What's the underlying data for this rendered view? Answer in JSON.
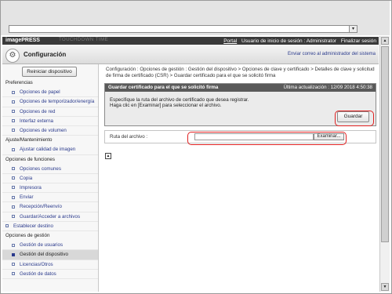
{
  "browser": {
    "dropdown_glyph": "▾"
  },
  "header": {
    "brand": "imagePRESS",
    "brand_ghost": "TOUCHDOWN TIME",
    "portal": "Portal",
    "user_label": "Usuario de inicio de sesión : Administrator",
    "logout": "Finalizar sesión"
  },
  "titlebar": {
    "icon": "gear-icon",
    "title": "Configuración",
    "email_link": "Enviar correo al administrador del sistema"
  },
  "sidebar": {
    "reset_button": "Reiniciar dispositivo",
    "nav": [
      {
        "type": "head",
        "label": "Preferencias"
      },
      {
        "type": "item",
        "label": "Opciones de papel"
      },
      {
        "type": "item",
        "label": "Opciones de temporizador/energía"
      },
      {
        "type": "item",
        "label": "Opciones de red"
      },
      {
        "type": "item",
        "label": "Interfaz externa"
      },
      {
        "type": "item",
        "label": "Opciones de volumen"
      },
      {
        "type": "head",
        "label": "Ajuste/Mantenimiento"
      },
      {
        "type": "item",
        "label": "Ajustar calidad de imagen"
      },
      {
        "type": "head",
        "label": "Opciones de funciones"
      },
      {
        "type": "item",
        "label": "Opciones comunes"
      },
      {
        "type": "item",
        "label": "Copia"
      },
      {
        "type": "item",
        "label": "Impresora"
      },
      {
        "type": "item",
        "label": "Enviar"
      },
      {
        "type": "item",
        "label": "Recepción/Reenvío"
      },
      {
        "type": "item",
        "label": "Guardar/Acceder a archivos"
      },
      {
        "type": "top",
        "label": "Establecer destino"
      },
      {
        "type": "head",
        "label": "Opciones de gestión"
      },
      {
        "type": "item",
        "label": "Gestión de usuarios"
      },
      {
        "type": "item",
        "label": "Gestión del dispositivo",
        "active": true
      },
      {
        "type": "item",
        "label": "Licencias/Otros"
      },
      {
        "type": "item",
        "label": "Gestión de datos"
      }
    ]
  },
  "main": {
    "breadcrumb": "Configuración : Opciones de gestión : Gestión del dispositivo > Opciones de clave y certificado > Detalles de clave y solicitud de firma de certificado (CSR) > Guardar certificado para el que se solicitó firma",
    "panel_title": "Guardar certificado para el que se solicitó firma",
    "last_update": "Última actualización : 12/09 2018 4:50:38",
    "instruction_line1": "Especifique la ruta del archivo de certificado que desea registrar.",
    "instruction_line2": "Haga clic en [Examinar] para seleccionar el archivo.",
    "save_button": "Guardar",
    "file_path_label": "Ruta del archivo :",
    "file_path_value": "",
    "browse_button": "Examinar...",
    "to_top_icon": "arrow-up-icon",
    "to_top_glyph": "▲"
  },
  "colors": {
    "highlight": "#e02020",
    "link": "#2a3a8c",
    "header_bg": "#3a3a3a"
  }
}
